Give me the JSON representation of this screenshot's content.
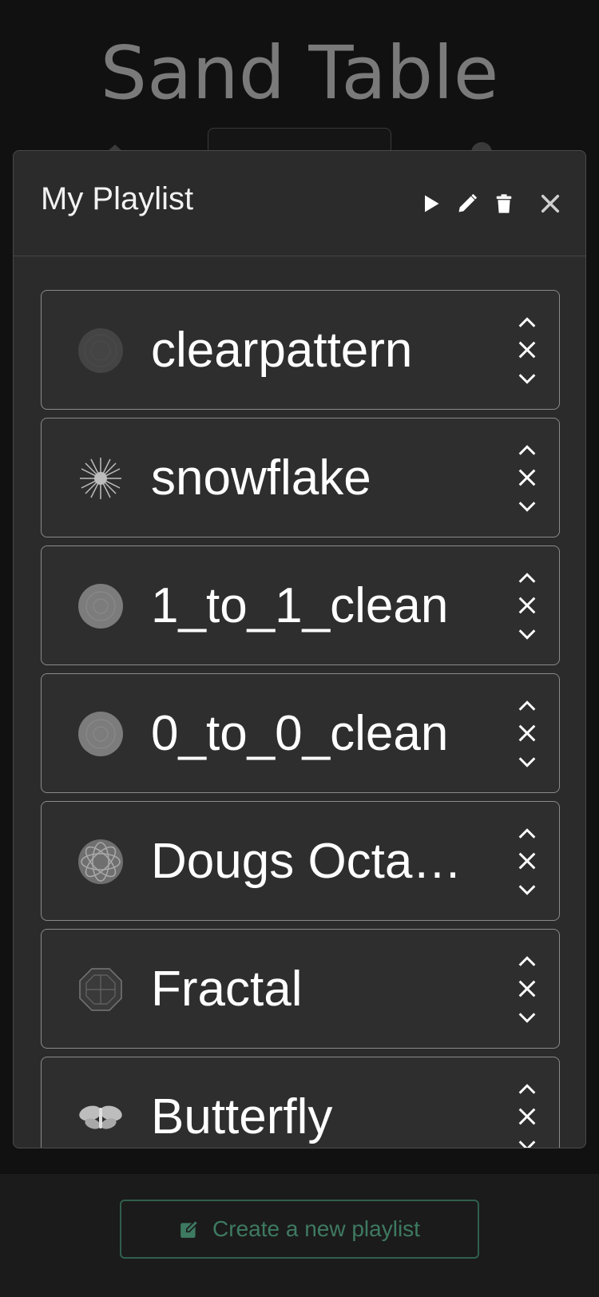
{
  "app": {
    "title": "Sand Table"
  },
  "playlist": {
    "name": "My Playlist",
    "items": [
      {
        "name": "clearpattern",
        "thumb": "dark-disc"
      },
      {
        "name": "snowflake",
        "thumb": "snowflake"
      },
      {
        "name": "1_to_1_clean",
        "thumb": "grey-disc"
      },
      {
        "name": "0_to_0_clean",
        "thumb": "grey-disc"
      },
      {
        "name": "Dougs Octa…",
        "thumb": "rosette"
      },
      {
        "name": "Fractal",
        "thumb": "octagon"
      },
      {
        "name": "Butterfly",
        "thumb": "butterfly"
      }
    ]
  },
  "footer": {
    "new_playlist_label": "Create a new playlist"
  },
  "colors": {
    "accent": "#3e7a61",
    "modal_bg": "#2b2b2b",
    "page_bg": "#111111"
  }
}
